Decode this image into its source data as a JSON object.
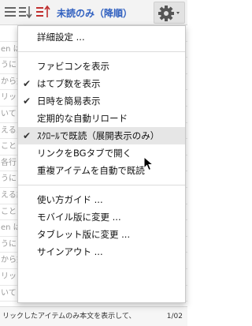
{
  "toolbar": {
    "title": "未読のみ（降順）",
    "accent": "#3060c0"
  },
  "background": {
    "rows": [
      "",
      "en は",
      "うに",
      "から好",
      "リック",
      "いて",
      "える.",
      "ことは",
      "各行を",
      "うに",
      "える記",
      "ことは",
      "en は",
      "うに",
      "から好",
      "リック",
      "いて"
    ]
  },
  "status_bar": {
    "text": "リックしたアイテムのみ本文を表示して、",
    "page": "1/02"
  },
  "menu": {
    "items": [
      {
        "label": "詳細設定 ...",
        "checked": false
      },
      {
        "label": "ファビコンを表示",
        "checked": false
      },
      {
        "label": "はてブ数を表示",
        "checked": true
      },
      {
        "label": "日時を簡易表示",
        "checked": true
      },
      {
        "label": "定期的な自動リロード",
        "checked": false
      },
      {
        "label": "ｽｸﾛｰﾙで既読（展開表示のみ）",
        "checked": true,
        "highlighted": true
      },
      {
        "label": "リンクをBGタブで開く",
        "checked": false
      },
      {
        "label": "重複アイテムを自動で既読",
        "checked": false
      },
      {
        "label": "使い方ガイド ...",
        "checked": false
      },
      {
        "label": "モバイル版に変更 ...",
        "checked": false
      },
      {
        "label": "タブレット版に変更 ...",
        "checked": false
      },
      {
        "label": "サインアウト ...",
        "checked": false
      }
    ],
    "check_mark": "✔"
  }
}
